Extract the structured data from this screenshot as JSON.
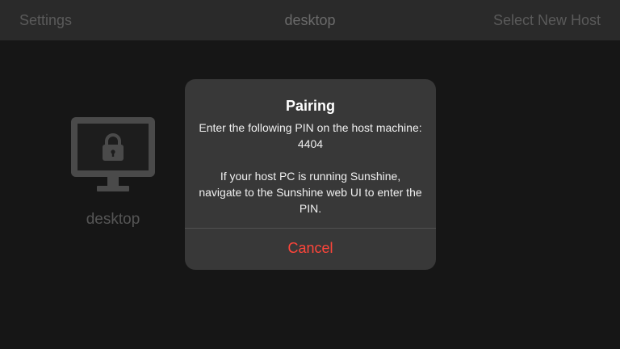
{
  "navbar": {
    "left_label": "Settings",
    "title": "desktop",
    "right_label": "Select New Host"
  },
  "host": {
    "label": "desktop",
    "icon": "monitor-lock-icon"
  },
  "dialog": {
    "title": "Pairing",
    "message_line1": "Enter the following PIN on the host machine: 4404",
    "message_line2": "If your host PC is running Sunshine, navigate to the Sunshine web UI to enter the PIN.",
    "pin": "4404",
    "cancel_label": "Cancel"
  },
  "colors": {
    "background": "#161616",
    "navbar": "#2a2a2a",
    "dialog": "#383838",
    "destructive": "#ff453a"
  }
}
